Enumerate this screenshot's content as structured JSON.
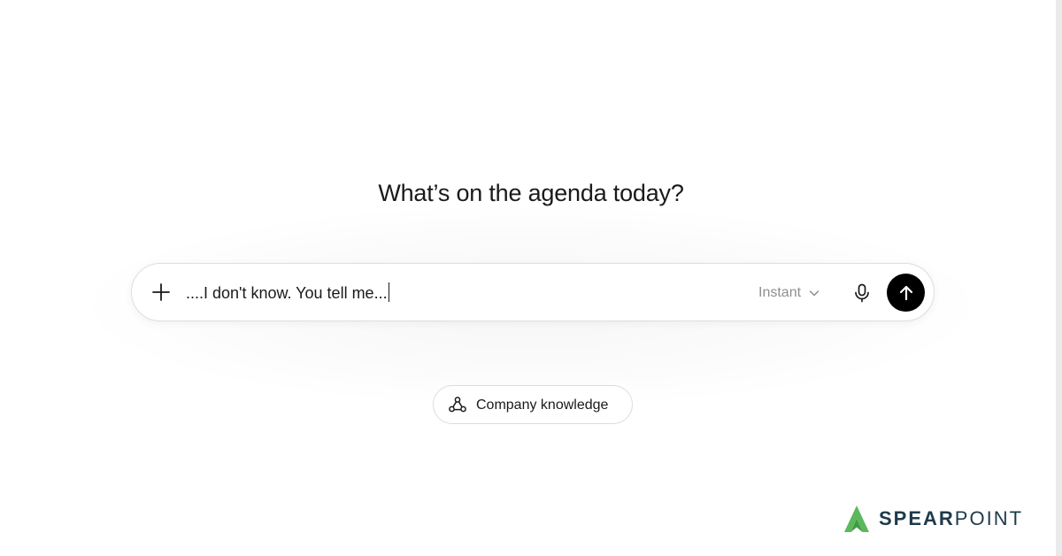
{
  "headline": "What’s on the agenda today?",
  "composer": {
    "value": "....I don't know. You tell me...",
    "model_label": "Instant",
    "icons": {
      "attach": "plus-icon",
      "model_dropdown": "chevron-down-icon",
      "voice": "microphone-icon",
      "send": "arrow-up-icon"
    }
  },
  "chips": [
    {
      "label": "Company knowledge",
      "icon": "knowledge-network-icon"
    }
  ],
  "brand": {
    "name_bold": "SPEAR",
    "name_light": "POINT",
    "mark_color": "#5cb85c",
    "text_color": "#1f3a4a"
  },
  "colors": {
    "send_button": "#000000",
    "muted_text": "#8f8f8f",
    "border": "#dedede"
  }
}
